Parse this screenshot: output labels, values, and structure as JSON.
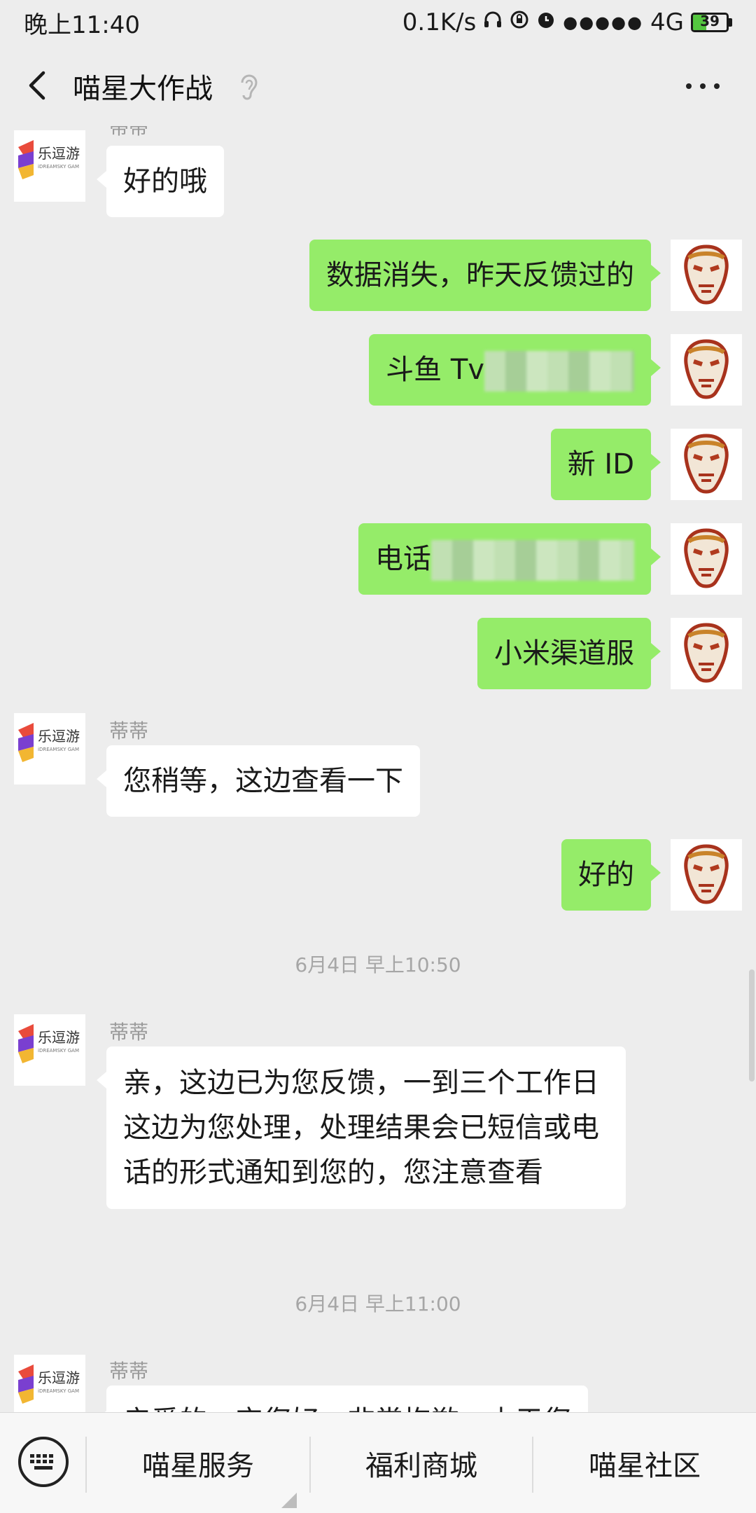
{
  "status_bar": {
    "time": "晚上11:40",
    "net_speed": "0.1K/s",
    "signal_dots": "●●●●●",
    "network": "4G",
    "battery": "39",
    "battery_level": 0.39
  },
  "nav": {
    "title": "喵星大作战",
    "back_icon": "chevron-left-icon",
    "ear_icon": "ear-icon",
    "more_icon": "more-icon"
  },
  "chat": {
    "contact_name": "蒂蒂",
    "msg_in_1": "好的哦",
    "msg_out_1": "数据消失，昨天反馈过的",
    "msg_out_2": "斗鱼 Tv",
    "msg_out_3": "新 ID",
    "msg_out_4": "电话",
    "msg_out_5": "小米渠道服",
    "msg_in_2": "您稍等，这边查看一下",
    "msg_out_6": "好的",
    "time_1": "6月4日 早上10:50",
    "msg_in_3": "亲，这边已为您反馈，一到三个工作日这边为您处理，处理结果会已短信或电话的形式通知到您的，您注意查看",
    "time_2": "6月4日 早上11:00",
    "msg_in_4": "亲爱的，宝您好，非常抱歉，由于您"
  },
  "bottom_menu": {
    "item_1": "喵星服务",
    "item_2": "福利商城",
    "item_3": "喵星社区",
    "keyboard_icon": "keyboard-icon"
  },
  "colors": {
    "outgoing_bubble": "#95ec69",
    "incoming_bubble": "#ffffff",
    "background": "#ededed"
  }
}
